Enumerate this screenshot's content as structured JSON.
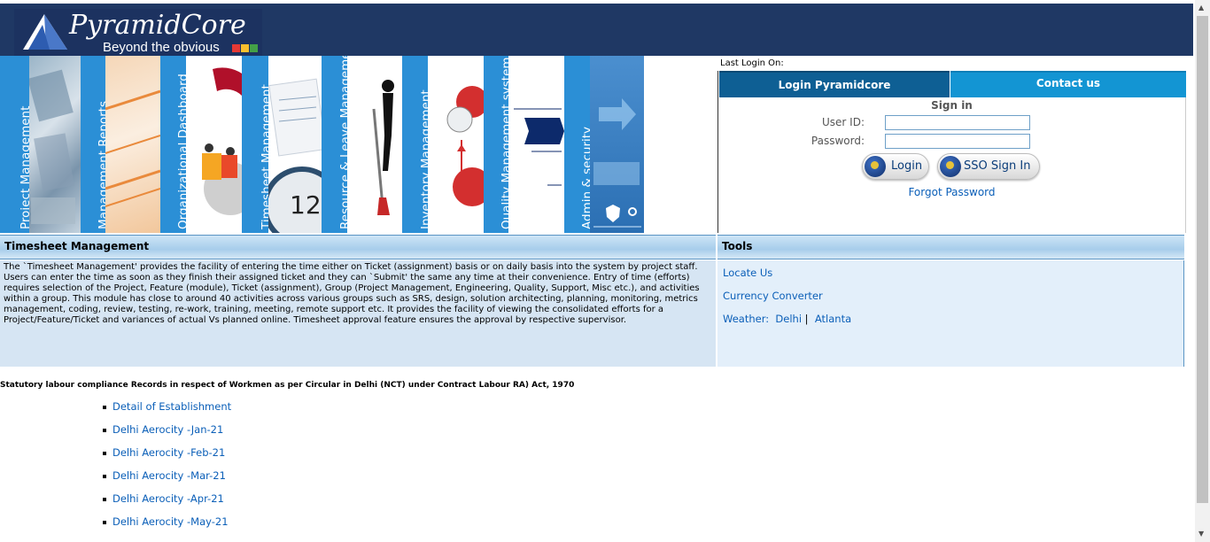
{
  "header": {
    "brand": "PyramidCore",
    "tagline": "Beyond the obvious",
    "brand_colors": [
      "#e53935",
      "#fbc02d",
      "#43a047"
    ]
  },
  "banner": {
    "modules": [
      "Project Management",
      "Management Reports",
      "Organizational Dashboard",
      "Timesheet Management",
      "Resource & Leave Management",
      "Inventory Management",
      "Quality Management system",
      "Admin & security"
    ]
  },
  "login": {
    "last_login": "Last Login On:",
    "tab_login": "Login Pyramidcore",
    "tab_contact": "Contact us",
    "signin_title": "Sign in",
    "userid_label": "User ID:",
    "password_label": "Password:",
    "login_button": "Login",
    "sso_button": "SSO Sign In",
    "forgot": "Forgot Password"
  },
  "timesheet": {
    "title": "Timesheet Management",
    "body": "The `Timesheet Management' provides the facility of entering the time either on Ticket (assignment) basis or on daily basis into the system by project staff. Users can enter the time as soon as they finish their assigned ticket and they can `Submit' the same any time at their convenience. Entry of time (efforts) requires selection of the Project, Feature (module), Ticket (assignment), Group (Project Management, Engineering, Quality, Support, Misc etc.), and activities within a group. This module has close to around 40 activities across various groups such as SRS, design, solution architecting, planning, monitoring, metrics management, coding, review, testing, re-work, training, meeting, remote support etc. It provides the facility of viewing the consolidated efforts for a Project/Feature/Ticket and variances of actual Vs planned online. Timesheet approval feature ensures the approval by respective supervisor."
  },
  "tools": {
    "title": "Tools",
    "locate_us": "Locate Us",
    "currency_converter": "Currency Converter",
    "weather_label": "Weather:",
    "weather_city1": "Delhi",
    "weather_sep": "|",
    "weather_city2": "Atlanta"
  },
  "statutory": {
    "heading": "Statutory labour compliance Records in respect of Workmen as per Circular in Delhi (NCT) under Contract Labour RA) Act, 1970",
    "links": [
      "Detail of Establishment",
      "Delhi Aerocity -Jan-21",
      "Delhi Aerocity -Feb-21",
      "Delhi Aerocity -Mar-21",
      "Delhi Aerocity -Apr-21",
      "Delhi Aerocity -May-21"
    ]
  }
}
